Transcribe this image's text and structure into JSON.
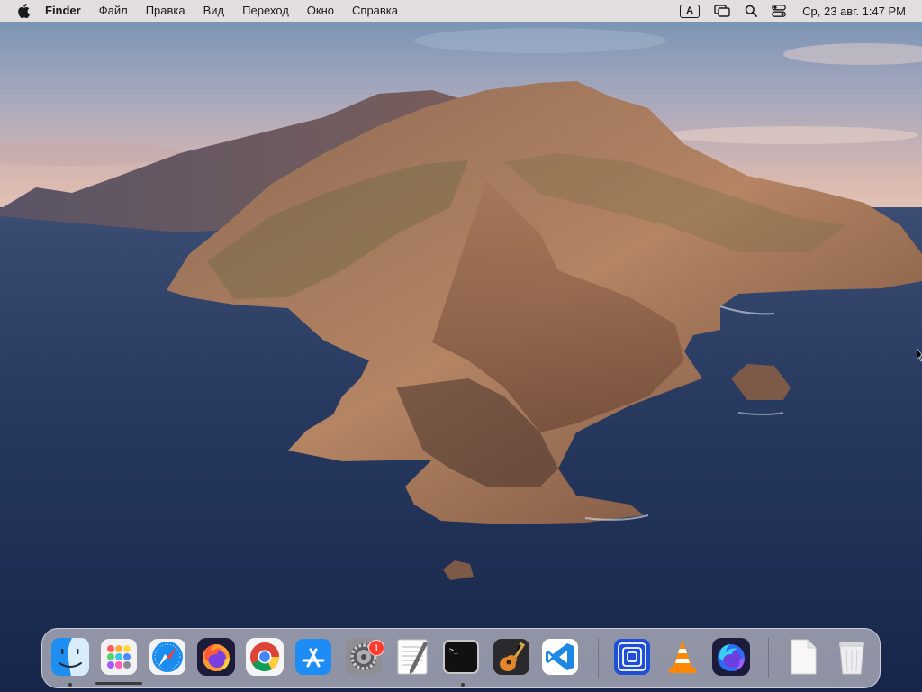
{
  "menubar": {
    "apple_icon": "apple-logo-icon",
    "app_name": "Finder",
    "menus": [
      {
        "id": "file",
        "label": "Файл"
      },
      {
        "id": "edit",
        "label": "Правка"
      },
      {
        "id": "view",
        "label": "Вид"
      },
      {
        "id": "go",
        "label": "Переход"
      },
      {
        "id": "window",
        "label": "Окно"
      },
      {
        "id": "help",
        "label": "Справка"
      }
    ],
    "status": {
      "input_source": "A",
      "screen_mirroring_icon": "screen-mirroring-icon",
      "spotlight_icon": "search-icon",
      "control_center_icon": "control-center-icon",
      "clock": "Ср, 23 авг.  1:47 PM"
    }
  },
  "dock": {
    "apps": [
      {
        "name": "Finder",
        "icon": "finder-icon",
        "running": true
      },
      {
        "name": "Launchpad",
        "icon": "launchpad-icon",
        "running": false
      },
      {
        "name": "Safari",
        "icon": "safari-icon",
        "running": false
      },
      {
        "name": "Firefox",
        "icon": "firefox-icon",
        "running": false
      },
      {
        "name": "Google Chrome",
        "icon": "chrome-icon",
        "running": false
      },
      {
        "name": "App Store",
        "icon": "app-store-icon",
        "running": false
      },
      {
        "name": "System Preferences",
        "icon": "system-preferences-icon",
        "running": false,
        "badge": "1"
      },
      {
        "name": "TextEdit",
        "icon": "textedit-icon",
        "running": false
      },
      {
        "name": "Terminal",
        "icon": "terminal-icon",
        "running": true
      },
      {
        "name": "GarageBand",
        "icon": "garageband-icon",
        "running": false
      },
      {
        "name": "Visual Studio Code",
        "icon": "vscode-icon",
        "running": false
      }
    ],
    "recent_apps": [
      {
        "name": "Screen",
        "icon": "concentric-squares-icon"
      },
      {
        "name": "VLC",
        "icon": "vlc-icon"
      },
      {
        "name": "Firefox Developer Edition",
        "icon": "firefox-developer-icon"
      }
    ],
    "trailing": [
      {
        "name": "Documents",
        "icon": "document-stack-icon"
      },
      {
        "name": "Trash",
        "icon": "trash-icon"
      }
    ]
  },
  "desktop": {
    "wallpaper": "macOS Catalina island at dusk"
  },
  "colors": {
    "menubar_bg": "#ece5e2",
    "dock_bg": "#f2ecee",
    "badge": "#ff3b30",
    "sea": "#1e2e52",
    "sky_top": "#6f8fb3",
    "sky_horizon": "#d9b8b0"
  }
}
